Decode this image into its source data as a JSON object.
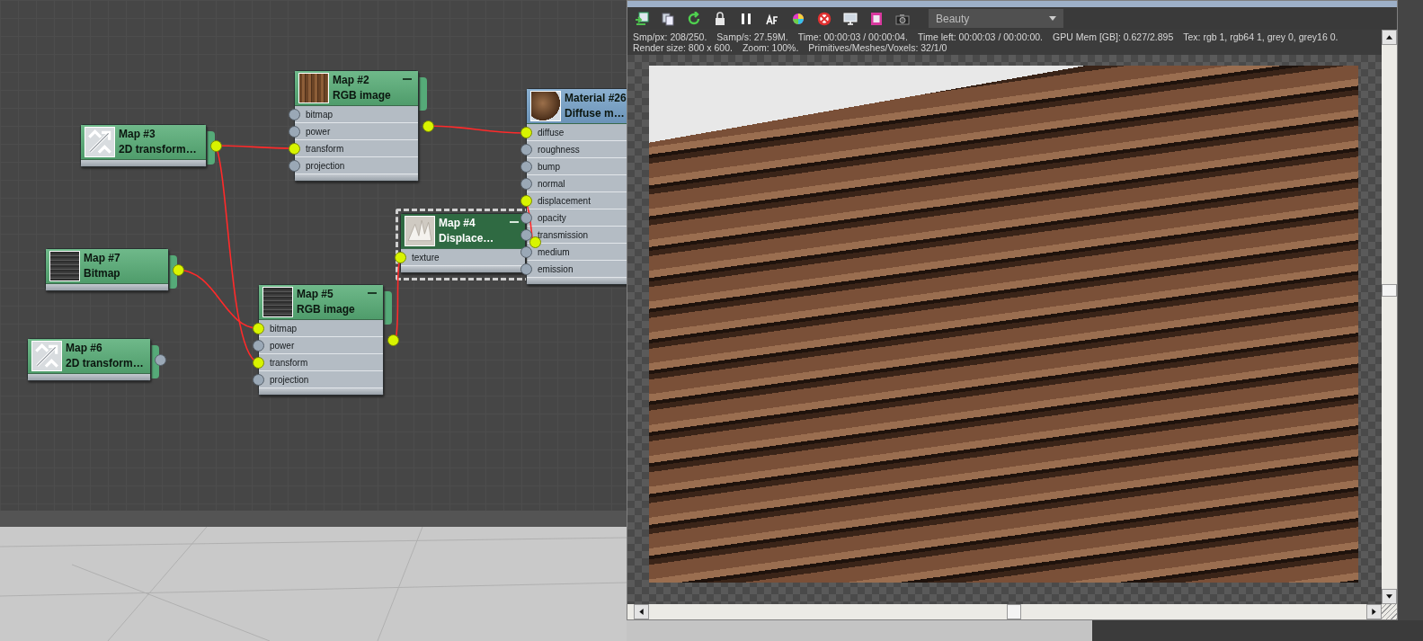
{
  "node_editor": {
    "nodes": [
      {
        "kind": "map",
        "title": "Map #2",
        "subtitle": "RGB image",
        "thumbnail": {
          "kind": "wood"
        },
        "selected": false,
        "collapse_button": true,
        "output_connected": true,
        "ports": [
          {
            "label": "bitmap",
            "connected": false
          },
          {
            "label": "power",
            "connected": false
          },
          {
            "label": "transform",
            "connected": true
          },
          {
            "label": "projection",
            "connected": false
          }
        ]
      },
      {
        "kind": "map",
        "title": "Map #3",
        "subtitle": "2D transform…",
        "thumbnail": {
          "kind": "transform"
        },
        "selected": false,
        "collapse_button": false,
        "output_connected": true
      },
      {
        "kind": "material",
        "title": "Material #26",
        "subtitle": "Diffuse m…",
        "thumbnail": {
          "kind": "sphere"
        },
        "selected": false,
        "collapse_button": false,
        "ports": [
          {
            "label": "diffuse",
            "connected": true
          },
          {
            "label": "roughness",
            "connected": false
          },
          {
            "label": "bump",
            "connected": false
          },
          {
            "label": "normal",
            "connected": false
          },
          {
            "label": "displacement",
            "connected": true
          },
          {
            "label": "opacity",
            "connected": false
          },
          {
            "label": "transmission",
            "connected": false
          },
          {
            "label": "medium",
            "connected": false
          },
          {
            "label": "emission",
            "connected": false
          }
        ]
      },
      {
        "kind": "map",
        "title": "Map #4",
        "subtitle": "Displace…",
        "thumbnail": {
          "kind": "displacement"
        },
        "selected": true,
        "collapse_button": true,
        "output_connected": true,
        "ports": [
          {
            "label": "texture",
            "connected": true
          }
        ]
      },
      {
        "kind": "map",
        "title": "Map #7",
        "subtitle": "Bitmap",
        "thumbnail": {
          "kind": "bark"
        },
        "selected": false,
        "collapse_button": false,
        "output_connected": true
      },
      {
        "kind": "map",
        "title": "Map #5",
        "subtitle": "RGB image",
        "thumbnail": {
          "kind": "bark"
        },
        "selected": false,
        "collapse_button": true,
        "output_connected": true,
        "ports": [
          {
            "label": "bitmap",
            "connected": true
          },
          {
            "label": "power",
            "connected": false
          },
          {
            "label": "transform",
            "connected": true
          },
          {
            "label": "projection",
            "connected": false
          }
        ]
      },
      {
        "kind": "map",
        "title": "Map #6",
        "subtitle": "2D transform…",
        "thumbnail": {
          "kind": "transform"
        },
        "selected": false,
        "collapse_button": false,
        "output_connected": false
      }
    ]
  },
  "viewport": {
    "render_pass": "Beauty",
    "stats": [
      [
        "Smp/px: 208/250.",
        "Samp/s: 27.59M.",
        "Time: 00:00:03 / 00:00:04.",
        "Time left: 00:00:03 / 00:00:00.",
        "GPU Mem [GB]: 0.627/2.895",
        "Tex: rgb 1, rgb64 1, grey 0, grey16 0."
      ],
      [
        "Render size: 800 x 600.",
        "Zoom: 100%.",
        "Primitives/Meshes/Voxels: 32/1/0"
      ]
    ]
  }
}
